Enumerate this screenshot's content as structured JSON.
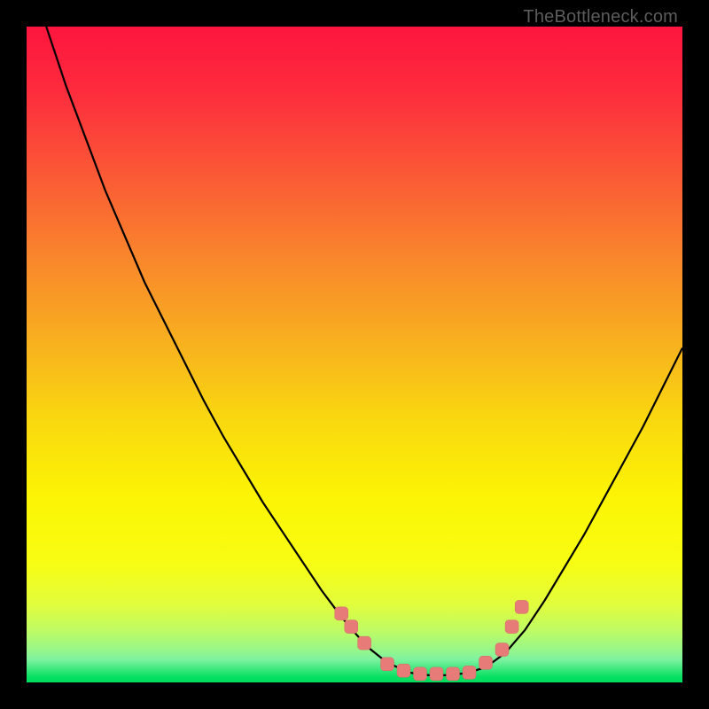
{
  "watermark": "TheBottleneck.com",
  "colors": {
    "frame": "#000000",
    "curve": "#000000",
    "marker_fill": "#e77b77",
    "marker_stroke": "#d46b67",
    "green_band_top": "#7ff2a0",
    "green_band_bottom": "#05e061"
  },
  "chart_data": {
    "type": "line",
    "title": "",
    "xlabel": "",
    "ylabel": "",
    "xlim": [
      0,
      100
    ],
    "ylim": [
      0,
      100
    ],
    "grid": false,
    "curve": {
      "name": "bottleneck-curve",
      "x": [
        0,
        3,
        6,
        9,
        12,
        15,
        18,
        21,
        24,
        27,
        30,
        33,
        36,
        39,
        42,
        45,
        46.5,
        48,
        49.5,
        51,
        52.5,
        54,
        55.5,
        57,
        58.5,
        60,
        61.5,
        64,
        67,
        70,
        73,
        76,
        79,
        82,
        85,
        88,
        91,
        94,
        97,
        100
      ],
      "y": [
        120,
        100,
        91,
        83,
        75,
        68,
        61,
        55,
        49,
        43,
        37.5,
        32.5,
        27.5,
        23,
        18.5,
        14,
        12,
        10,
        8.2,
        6.5,
        5,
        3.8,
        2.8,
        2.1,
        1.5,
        1.2,
        1.1,
        1.1,
        1.4,
        2.3,
        4.5,
        8,
        12.5,
        17.5,
        22.5,
        28,
        33.5,
        39,
        45,
        51
      ]
    },
    "markers": {
      "name": "optimal-band-points",
      "points": [
        {
          "x": 48.0,
          "y": 10.5
        },
        {
          "x": 49.5,
          "y": 8.5
        },
        {
          "x": 51.5,
          "y": 6.0
        },
        {
          "x": 55.0,
          "y": 2.8
        },
        {
          "x": 57.5,
          "y": 1.8
        },
        {
          "x": 60.0,
          "y": 1.3
        },
        {
          "x": 62.5,
          "y": 1.3
        },
        {
          "x": 65.0,
          "y": 1.3
        },
        {
          "x": 67.5,
          "y": 1.5
        },
        {
          "x": 70.0,
          "y": 3.0
        },
        {
          "x": 72.5,
          "y": 5.0
        },
        {
          "x": 74.0,
          "y": 8.5
        },
        {
          "x": 75.5,
          "y": 11.5
        }
      ]
    },
    "gradient_stops": [
      {
        "pos": 0.0,
        "color": "#fd153e"
      },
      {
        "pos": 0.1,
        "color": "#fd2c3d"
      },
      {
        "pos": 0.22,
        "color": "#fb5736"
      },
      {
        "pos": 0.35,
        "color": "#f9852c"
      },
      {
        "pos": 0.48,
        "color": "#f8b01f"
      },
      {
        "pos": 0.6,
        "color": "#f9d80f"
      },
      {
        "pos": 0.72,
        "color": "#fcf504"
      },
      {
        "pos": 0.82,
        "color": "#f7fd14"
      },
      {
        "pos": 0.88,
        "color": "#e2fd3c"
      },
      {
        "pos": 0.92,
        "color": "#c0fb63"
      },
      {
        "pos": 0.948,
        "color": "#9af786"
      },
      {
        "pos": 0.965,
        "color": "#7ff2a0"
      },
      {
        "pos": 0.992,
        "color": "#05e061"
      },
      {
        "pos": 1.0,
        "color": "#02dd5f"
      }
    ]
  }
}
